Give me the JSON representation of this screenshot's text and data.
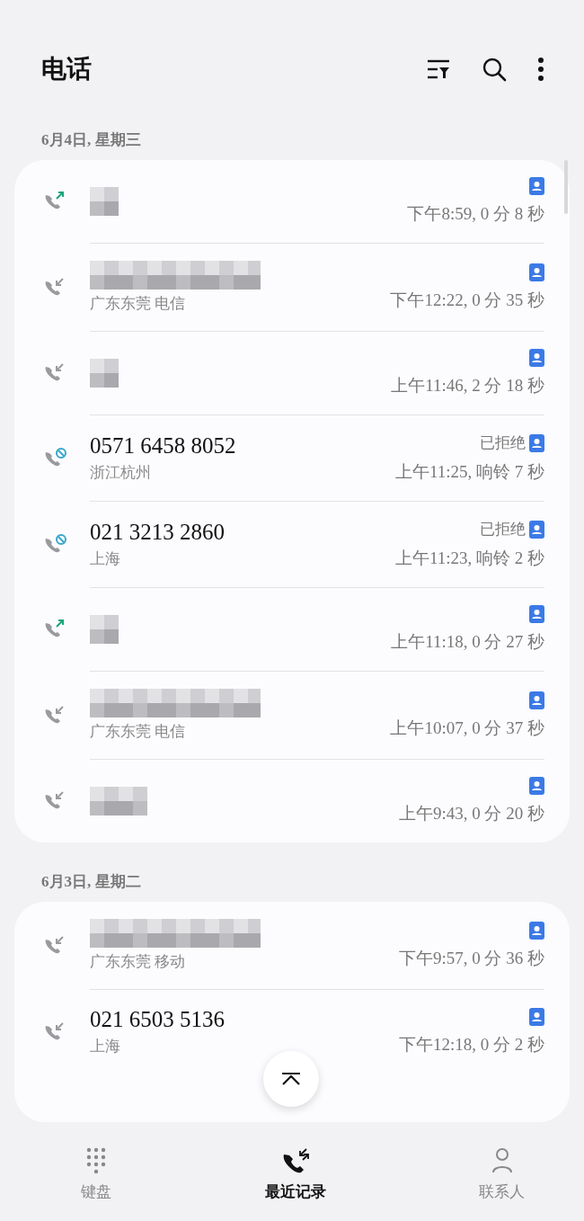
{
  "header": {
    "title": "电话"
  },
  "sections": [
    {
      "date": "6月4日, 星期三",
      "calls": [
        {
          "kind": "outgoing",
          "name_blurred": true,
          "time": "下午8:59, 0 分 8 秒"
        },
        {
          "kind": "incoming",
          "name_blurred": true,
          "location": "广东东莞 电信",
          "time": "下午12:22, 0 分 35 秒"
        },
        {
          "kind": "incoming",
          "name_blurred": true,
          "time": "上午11:46, 2 分 18 秒"
        },
        {
          "kind": "rejected",
          "number": "0571 6458 8052",
          "location": "浙江杭州",
          "status": "已拒绝",
          "time": "上午11:25, 响铃 7 秒"
        },
        {
          "kind": "rejected",
          "number": "021 3213 2860",
          "location": "上海",
          "status": "已拒绝",
          "time": "上午11:23, 响铃 2 秒"
        },
        {
          "kind": "outgoing",
          "name_blurred": true,
          "time": "上午11:18, 0 分 27 秒"
        },
        {
          "kind": "incoming",
          "name_blurred": true,
          "location": "广东东莞 电信",
          "time": "上午10:07, 0 分 37 秒"
        },
        {
          "kind": "incoming",
          "name_blurred": true,
          "time": "上午9:43, 0 分 20 秒"
        }
      ]
    },
    {
      "date": "6月3日, 星期二",
      "calls": [
        {
          "kind": "incoming",
          "name_blurred": true,
          "location": "广东东莞 移动",
          "time": "下午9:57, 0 分 36 秒"
        },
        {
          "kind": "incoming",
          "number": "021 6503 5136",
          "location": "上海",
          "time": "下午12:18, 0 分 2 秒"
        }
      ]
    }
  ],
  "bottom_nav": [
    {
      "label": "键盘",
      "selected": false
    },
    {
      "label": "最近记录",
      "selected": true
    },
    {
      "label": "联系人",
      "selected": false
    }
  ]
}
